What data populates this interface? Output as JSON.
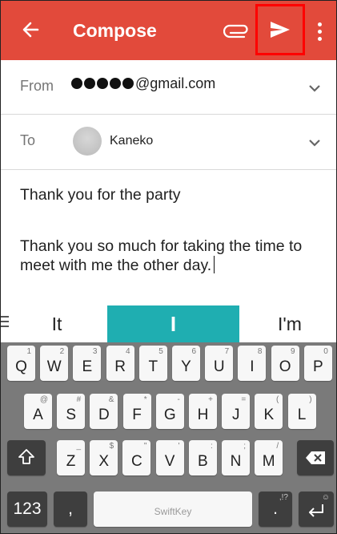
{
  "appbar": {
    "title": "Compose",
    "bg_color": "#e24a3b",
    "highlight_color": "#ff0000",
    "icons": [
      "back-arrow-icon",
      "attach-icon",
      "send-icon",
      "more-vert-icon"
    ]
  },
  "from": {
    "label": "From",
    "masked_dots": 5,
    "email_suffix": "@gmail.com"
  },
  "to": {
    "label": "To",
    "recipient": "Kaneko"
  },
  "subject": "Thank you for the party",
  "body": "Thank you so much for taking the time to meet with me the other day.",
  "suggestions": {
    "left": "It",
    "center": "I",
    "right": "I'm",
    "accent_color": "#1faeb1"
  },
  "keyboard": {
    "row1": [
      {
        "k": "Q",
        "a": "1"
      },
      {
        "k": "W",
        "a": "2"
      },
      {
        "k": "E",
        "a": "3"
      },
      {
        "k": "R",
        "a": "4"
      },
      {
        "k": "T",
        "a": "5"
      },
      {
        "k": "Y",
        "a": "6"
      },
      {
        "k": "U",
        "a": "7"
      },
      {
        "k": "I",
        "a": "8"
      },
      {
        "k": "O",
        "a": "9"
      },
      {
        "k": "P",
        "a": "0"
      }
    ],
    "row2": [
      {
        "k": "A",
        "a": "@"
      },
      {
        "k": "S",
        "a": "#"
      },
      {
        "k": "D",
        "a": "&"
      },
      {
        "k": "F",
        "a": "*"
      },
      {
        "k": "G",
        "a": "-"
      },
      {
        "k": "H",
        "a": "+"
      },
      {
        "k": "J",
        "a": "="
      },
      {
        "k": "K",
        "a": "("
      },
      {
        "k": "L",
        "a": ")"
      }
    ],
    "row3": [
      {
        "k": "Z",
        "a": "_"
      },
      {
        "k": "X",
        "a": "$"
      },
      {
        "k": "C",
        "a": "\""
      },
      {
        "k": "V",
        "a": "'"
      },
      {
        "k": "B",
        "a": ":"
      },
      {
        "k": "N",
        "a": ";"
      },
      {
        "k": "M",
        "a": "/"
      }
    ],
    "num_label": "123",
    "comma_label": ",",
    "space_label": "SwiftKey",
    "punct_label": ".",
    "punct_alt": ",!?",
    "enter_alt": "☺"
  }
}
